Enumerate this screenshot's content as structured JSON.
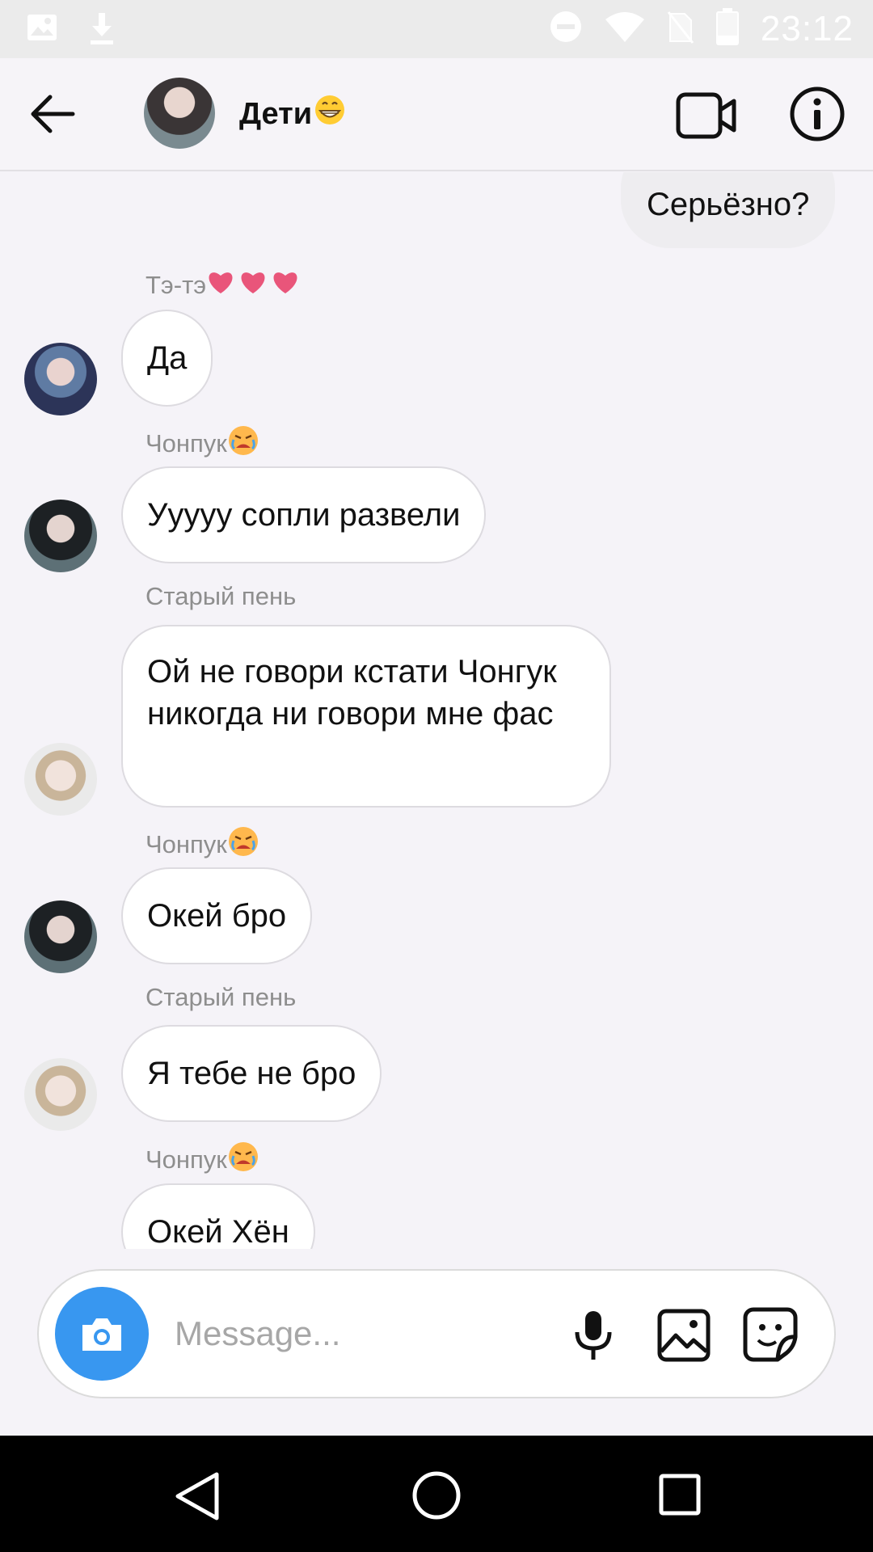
{
  "status_bar": {
    "time": "23:12",
    "icons": [
      "image-icon",
      "download-icon",
      "do-not-disturb-icon",
      "wifi-icon",
      "no-sim-icon",
      "battery-icon"
    ]
  },
  "header": {
    "back_icon": "arrow-left-icon",
    "title": "Дети",
    "title_emoji": "grinning-emoji",
    "video_icon": "video-camera-icon",
    "info_icon": "info-icon"
  },
  "messages": [
    {
      "type": "outgoing",
      "text": "Серьёзно?"
    },
    {
      "type": "incoming",
      "sender": "Тэ-тэ",
      "sender_emoji": "three-hearts",
      "text": "Да"
    },
    {
      "type": "incoming",
      "sender": "Чонпук",
      "sender_emoji": "crying-emoji",
      "text": "Ууууу сопли развели"
    },
    {
      "type": "incoming",
      "sender": "Старый пень",
      "text": "Ой не говори кстати Чонгук никогда ни говори мне фас"
    },
    {
      "type": "incoming",
      "sender": "Чонпук",
      "sender_emoji": "crying-emoji",
      "text": "Окей бро"
    },
    {
      "type": "incoming",
      "sender": "Старый пень",
      "text": "Я тебе не бро"
    },
    {
      "type": "incoming",
      "sender": "Чонпук",
      "sender_emoji": "crying-emoji",
      "text": "Окей Хён"
    }
  ],
  "composer": {
    "camera_icon": "camera-icon",
    "placeholder": "Message...",
    "value": "",
    "mic_icon": "microphone-icon",
    "gallery_icon": "gallery-icon",
    "sticker_icon": "sticker-icon"
  },
  "nav_bar": {
    "icons": [
      "nav-back-icon",
      "nav-home-icon",
      "nav-recents-icon"
    ]
  },
  "colors": {
    "accent": "#3897f0",
    "heart": "#e9557a",
    "sender_label": "#8e8e8e"
  }
}
